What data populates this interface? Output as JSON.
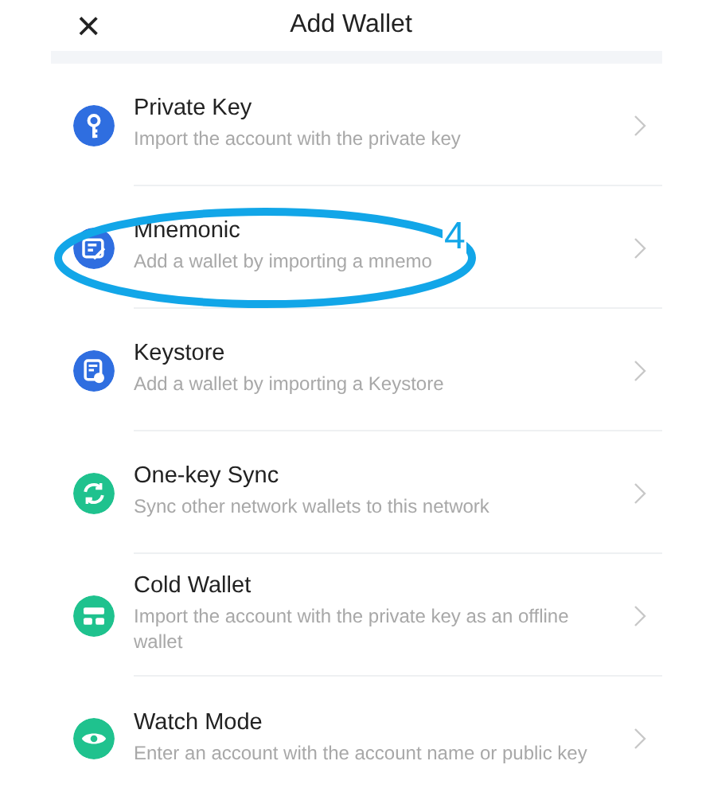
{
  "header": {
    "close": "×",
    "title": "Add Wallet"
  },
  "items": [
    {
      "title": "Private Key",
      "subtitle": "Import the account with the private key",
      "color": "#2f6ee0"
    },
    {
      "title": "Mnemonic",
      "subtitle": "Add a wallet by importing a mnemo",
      "color": "#2f6ee0",
      "annotation": {
        "label": "4"
      }
    },
    {
      "title": "Keystore",
      "subtitle": "Add a wallet by importing a Keystore",
      "color": "#2f6ee0"
    },
    {
      "title": "One-key Sync",
      "subtitle": "Sync other network wallets to this network",
      "color": "#1fc28e"
    },
    {
      "title": "Cold Wallet",
      "subtitle": "Import the account with the private key as an offline wallet",
      "color": "#1fc28e"
    },
    {
      "title": "Watch Mode",
      "subtitle": "Enter an account with the account name or public key",
      "color": "#1fc28e"
    }
  ]
}
